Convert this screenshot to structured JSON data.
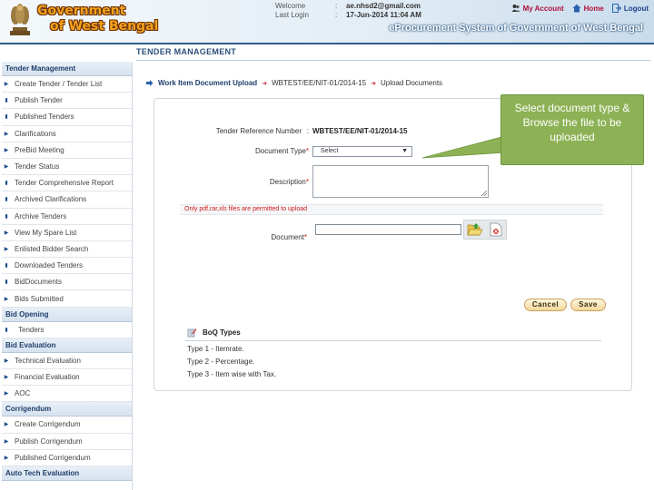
{
  "header": {
    "gov_line1": "Government",
    "gov_line2": "of West Bengal",
    "welcome_label": "Welcome",
    "welcome_value": "ae.nhsd2@gmail.com",
    "last_login_label": "Last Login",
    "last_login_value": "17-Jun-2014 11:04 AM",
    "separator": ":",
    "links": {
      "my_account": "My Account",
      "home": "Home",
      "logout": "Logout"
    },
    "system_title": "eProcurement System of Government of West Bengal"
  },
  "section_title": "TENDER MANAGEMENT",
  "sidebar": {
    "groups": [
      {
        "heading": "Tender Management",
        "items": [
          "Create Tender / Tender List",
          "Publish Tender",
          "Published Tenders",
          "Clarifications",
          "PreBid Meeting",
          "Tender Status",
          "Tender Comprehensive Report",
          "Archived Clarifications",
          "Archive Tenders",
          "View My Spare List",
          "Enlisted Bidder Search",
          "Downloaded Tenders",
          "BidDocuments",
          "Bids Submitted"
        ]
      },
      {
        "heading": "Bid Opening",
        "items": [
          "Tenders"
        ]
      },
      {
        "heading": "Bid Evaluation",
        "items": [
          "Technical Evaluation",
          "Financial Evaluation",
          "AOC"
        ]
      },
      {
        "heading": "Corrigendum",
        "items": [
          "Create Corrigendum",
          "Publish Corrigendum",
          "Published Corrigendum"
        ]
      },
      {
        "heading": "Auto Tech Evaluation",
        "items": []
      }
    ]
  },
  "breadcrumb": {
    "current": "Work Item Document Upload",
    "arrow": "➜",
    "ref": "WBTEST/EE/NIT-01/2014-15",
    "last": "Upload Documents"
  },
  "form": {
    "tender_ref_label": "Tender Reference Number",
    "tender_ref_sep": ":",
    "tender_ref_value": "WBTEST/EE/NIT-01/2014-15",
    "doc_type_label": "Document Type",
    "doc_type_selected": "Select",
    "description_label": "Description",
    "required_mark": "*",
    "file_note": "Only pdf,rar,xls files are permitted to upload",
    "document_label": "Document",
    "cancel_label": "Cancel",
    "save_label": "Save"
  },
  "boq": {
    "heading": "BoQ Types",
    "lines": [
      "Type 1 - Itemrate.",
      "Type 2 - Percentage.",
      "Type 3 - Item wise with Tax."
    ]
  },
  "callout": {
    "text": "Select document type & Browse the file to be uploaded",
    "color": "#8db255"
  }
}
